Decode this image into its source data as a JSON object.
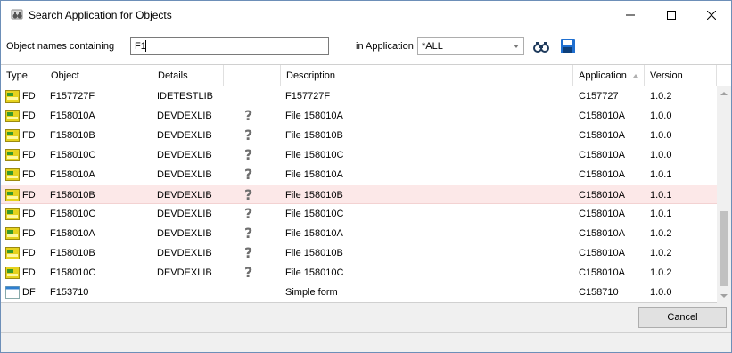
{
  "window": {
    "title": "Search Application for Objects",
    "icon": "binoculars-app-icon"
  },
  "search": {
    "names_label": "Object names containing",
    "names_value": "F1",
    "app_label": "in Application",
    "app_selected": "*ALL"
  },
  "toolbar": {
    "search_icon": "binoculars-icon",
    "save_icon": "floppy-disk-icon"
  },
  "table": {
    "columns": {
      "type": "Type",
      "object": "Object",
      "details": "Details",
      "blank": "",
      "description": "Description",
      "application": "Application",
      "version": "Version"
    },
    "rows": [
      {
        "icon": "form-yellow-icon",
        "type": "FD",
        "object": "F157727F",
        "details": "IDETESTLIB",
        "status": "",
        "description": "F157727F",
        "application": "C157727",
        "version": "1.0.2"
      },
      {
        "icon": "form-yellow-icon",
        "type": "FD",
        "object": "F158010A",
        "details": "DEVDEXLIB",
        "status": "?",
        "description": "File 158010A",
        "application": "C158010A",
        "version": "1.0.0"
      },
      {
        "icon": "form-yellow-icon",
        "type": "FD",
        "object": "F158010B",
        "details": "DEVDEXLIB",
        "status": "?",
        "description": "File 158010B",
        "application": "C158010A",
        "version": "1.0.0"
      },
      {
        "icon": "form-yellow-icon",
        "type": "FD",
        "object": "F158010C",
        "details": "DEVDEXLIB",
        "status": "?",
        "description": "File 158010C",
        "application": "C158010A",
        "version": "1.0.0"
      },
      {
        "icon": "form-yellow-icon",
        "type": "FD",
        "object": "F158010A",
        "details": "DEVDEXLIB",
        "status": "?",
        "description": "File 158010A",
        "application": "C158010A",
        "version": "1.0.1"
      },
      {
        "icon": "form-yellow-icon",
        "type": "FD",
        "object": "F158010B",
        "details": "DEVDEXLIB",
        "status": "?",
        "description": "File 158010B",
        "application": "C158010A",
        "version": "1.0.1",
        "selected": true
      },
      {
        "icon": "form-yellow-icon",
        "type": "FD",
        "object": "F158010C",
        "details": "DEVDEXLIB",
        "status": "?",
        "description": "File 158010C",
        "application": "C158010A",
        "version": "1.0.1"
      },
      {
        "icon": "form-yellow-icon",
        "type": "FD",
        "object": "F158010A",
        "details": "DEVDEXLIB",
        "status": "?",
        "description": "File 158010A",
        "application": "C158010A",
        "version": "1.0.2"
      },
      {
        "icon": "form-yellow-icon",
        "type": "FD",
        "object": "F158010B",
        "details": "DEVDEXLIB",
        "status": "?",
        "description": "File 158010B",
        "application": "C158010A",
        "version": "1.0.2"
      },
      {
        "icon": "form-yellow-icon",
        "type": "FD",
        "object": "F158010C",
        "details": "DEVDEXLIB",
        "status": "?",
        "description": "File 158010C",
        "application": "C158010A",
        "version": "1.0.2"
      },
      {
        "icon": "display-file-blue-icon",
        "type": "DF",
        "object": "F153710",
        "details": "",
        "status": "",
        "description": "Simple form",
        "application": "C158710",
        "version": "1.0.0"
      }
    ]
  },
  "footer": {
    "cancel_label": "Cancel"
  },
  "colors": {
    "selected_row": "#fce8e8",
    "form_icon_yellow": "#e6d21e",
    "form_icon_green": "#3a9a2a",
    "df_icon_blue": "#2f7fd0",
    "save_icon_blue": "#1f6fd0"
  }
}
